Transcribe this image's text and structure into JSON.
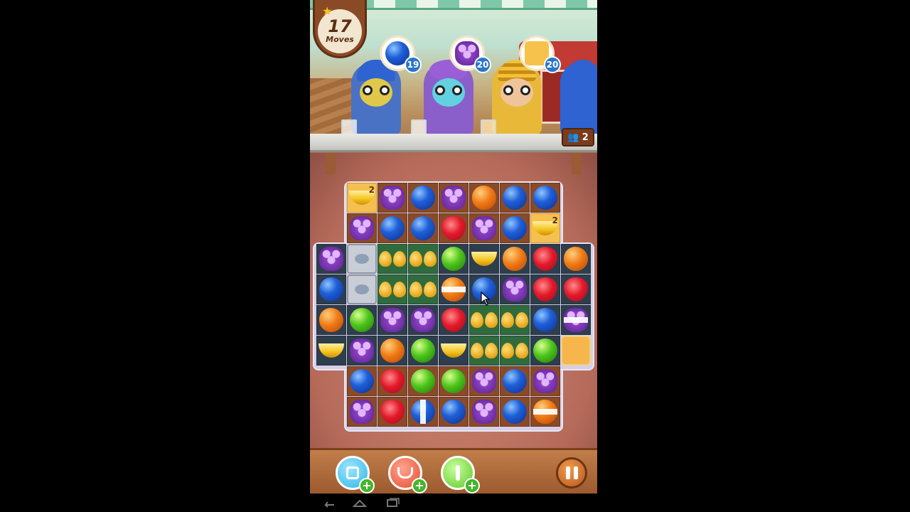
{
  "game": {
    "moves": {
      "count": "17",
      "label": "Moves"
    },
    "customers_remaining": "2",
    "goals": [
      {
        "fruit": "blueberry",
        "count": "19"
      },
      {
        "fruit": "grape",
        "count": "20"
      },
      {
        "fruit": "jam",
        "count": "20"
      }
    ]
  },
  "board": {
    "legend": {
      "B": "blueberry",
      "G": "grape",
      "O": "orange",
      "S": "strawberry",
      "A": "apple",
      "N": "banana",
      "X": "crate",
      "P": "pear-bush",
      "J": "jam-block",
      "_": "empty"
    },
    "rows": [
      [
        "_",
        "N2",
        "G",
        "B",
        "G",
        "O",
        "B",
        "B",
        "_"
      ],
      [
        "_",
        "G",
        "B",
        "B",
        "S",
        "G",
        "B",
        "N2",
        "_"
      ],
      [
        "G",
        "X",
        "P",
        "P",
        "A",
        "N",
        "O",
        "S",
        "O"
      ],
      [
        "B",
        "X",
        "P",
        "P",
        "O-striped",
        "B",
        "G",
        "S",
        "S"
      ],
      [
        "O",
        "A",
        "G",
        "G",
        "S",
        "P",
        "P",
        "B",
        "G-striped"
      ],
      [
        "N",
        "G",
        "O",
        "A",
        "N",
        "P",
        "P",
        "A",
        "J"
      ],
      [
        "_",
        "B",
        "S",
        "A",
        "A",
        "G",
        "B",
        "G",
        "_"
      ],
      [
        "_",
        "G",
        "S",
        "B-vstriped",
        "B",
        "G",
        "B",
        "O-striped",
        "_"
      ]
    ]
  },
  "boosters": [
    {
      "name": "shuffle-booster",
      "color": "#2fb6e8"
    },
    {
      "name": "swap-booster",
      "color": "#e84a2f"
    },
    {
      "name": "apple-booster",
      "color": "#5cc92a"
    }
  ],
  "colors": {
    "accent": "#8b4a26",
    "goal_badge": "#2b76c9"
  }
}
